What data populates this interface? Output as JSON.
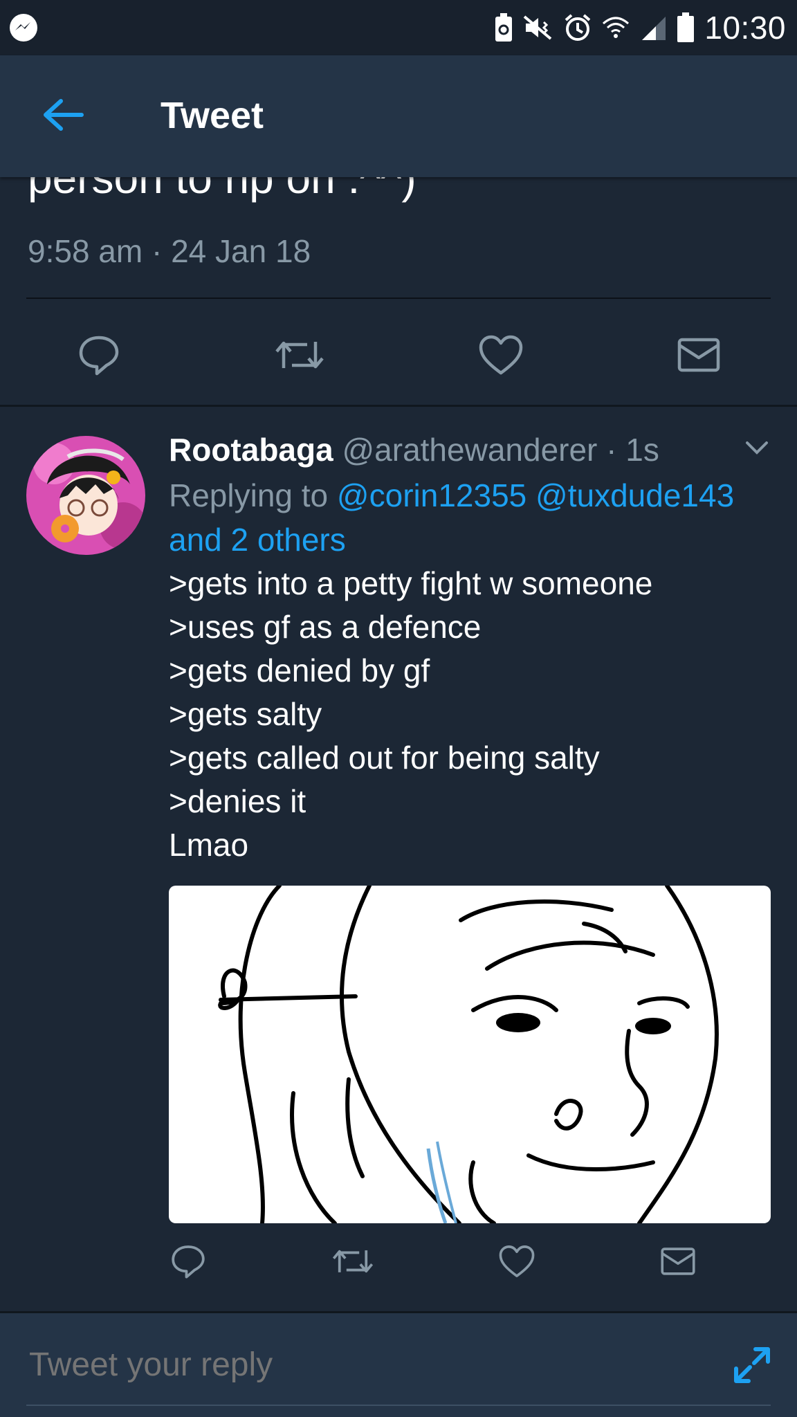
{
  "status_bar": {
    "time": "10:30",
    "icons": [
      "messenger-icon",
      "battery-saver-icon",
      "mute-vibrate-icon",
      "alarm-icon",
      "wifi-icon",
      "signal-icon",
      "battery-icon"
    ]
  },
  "header": {
    "title": "Tweet",
    "back_icon": "arrow-left-icon"
  },
  "previous_tweet": {
    "text_tail": "person to rip on :^^)",
    "timestamp": "9:58 am · 24 Jan 18",
    "actions": [
      "reply-icon",
      "retweet-icon",
      "like-icon",
      "message-icon"
    ]
  },
  "reply_tweet": {
    "display_name": "Rootabaga",
    "handle_time": "@arathewanderer · 1s",
    "replying_prefix": "Replying to",
    "mention_1": "@corin12355",
    "mention_2": "@tuxdude143",
    "and_others": "and 2 others",
    "lines": [
      ">gets into a petty fight w someone",
      ">uses gf as a defence",
      ">gets denied by gf",
      ">gets salty",
      ">gets called out for being salty",
      ">denies it",
      "Lmao"
    ],
    "actions": [
      "reply-icon",
      "retweet-icon",
      "like-icon",
      "message-icon"
    ]
  },
  "reply_box": {
    "placeholder": "Tweet your reply"
  },
  "colors": {
    "background": "#1c2735",
    "bar": "#243447",
    "accent": "#1da1f2",
    "muted": "#8899a6"
  }
}
